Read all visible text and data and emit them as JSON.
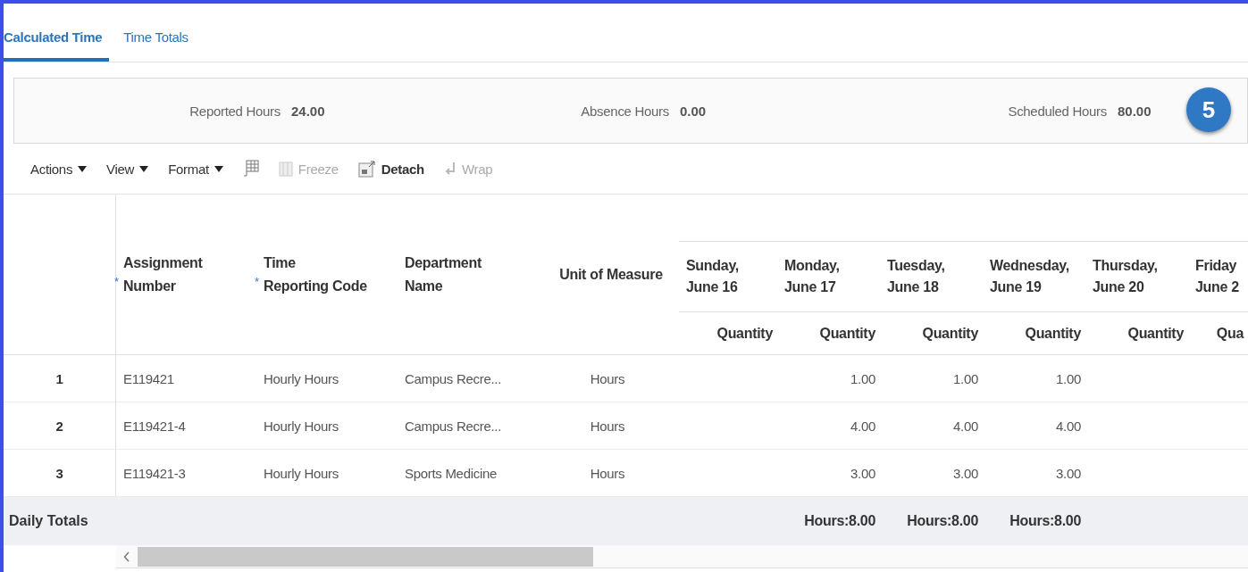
{
  "tabs": [
    {
      "label": "Calculated Time",
      "selected": true
    },
    {
      "label": "Time Totals",
      "selected": false
    }
  ],
  "summary": [
    {
      "label": "Reported Hours",
      "value": "24.00"
    },
    {
      "label": "Absence Hours",
      "value": "0.00"
    },
    {
      "label": "Scheduled Hours",
      "value": "80.00"
    }
  ],
  "step_badge": "5",
  "toolbar": [
    {
      "kind": "menu",
      "label": "Actions"
    },
    {
      "kind": "menu",
      "label": "View"
    },
    {
      "kind": "menu",
      "label": "Format"
    },
    {
      "kind": "icon"
    },
    {
      "kind": "button",
      "label": "Freeze",
      "disabled": true
    },
    {
      "kind": "button",
      "label": "Detach",
      "disabled": false
    },
    {
      "kind": "button",
      "label": "Wrap",
      "disabled": true
    }
  ],
  "table": {
    "columns": [
      {
        "label": "Assignment\nNumber",
        "required_mark": "*"
      },
      {
        "label": "Time\nReporting Code",
        "required_mark": "*"
      },
      {
        "label": "Department\nName"
      },
      {
        "label": "Unit of Measure"
      }
    ],
    "days": [
      {
        "label": "Sunday,\nJune 16",
        "sub": "Quantity"
      },
      {
        "label": "Monday,\nJune 17",
        "sub": "Quantity",
        "values": [
          "1.00",
          "4.00",
          "3.00"
        ],
        "total": "Hours:8.00"
      },
      {
        "label": "Tuesday,\nJune 18",
        "sub": "Quantity",
        "values": [
          "1.00",
          "4.00",
          "3.00"
        ],
        "total": "Hours:8.00"
      },
      {
        "label": "Wednesday,\nJune 19",
        "sub": "Quantity",
        "values": [
          "1.00",
          "4.00",
          "3.00"
        ],
        "total": "Hours:8.00"
      },
      {
        "label": "Thursday,\nJune 20",
        "sub": "Quantity"
      },
      {
        "label": "Friday\nJune 2",
        "sub": "Qua"
      }
    ],
    "rows": [
      {
        "number": "1",
        "cells": [
          "E119421",
          "Hourly Hours",
          "Campus Recre...",
          "Hours"
        ]
      },
      {
        "number": "2",
        "cells": [
          "E119421-4",
          "Hourly Hours",
          "Campus Recre...",
          "Hours"
        ]
      },
      {
        "number": "3",
        "cells": [
          "E119421-3",
          "Hourly Hours",
          "Sports Medicine",
          "Hours"
        ]
      }
    ],
    "totals": {
      "label": "Daily Totals"
    }
  }
}
